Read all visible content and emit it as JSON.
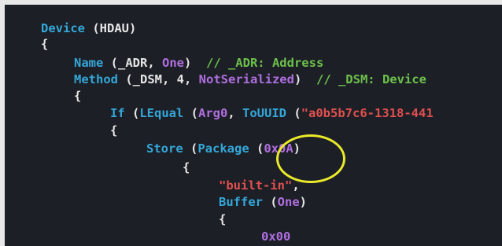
{
  "code": {
    "l1": {
      "kw": "Device",
      "rest": " (HDAU)"
    },
    "l2": {
      "text": "{"
    },
    "l3": {
      "kw": "Name",
      "p1": " (_ADR, ",
      "num": "One",
      "p2": ")  ",
      "comment": "// _ADR: Address"
    },
    "l4": {
      "kw": "Method",
      "p1": " (_DSM, 4, ",
      "num": "NotSerialized",
      "p2": ")  ",
      "comment": "// _DSM: Device"
    },
    "l5": {
      "text": "{"
    },
    "l6": {
      "kw1": "If",
      "p1": " (",
      "kw2": "LEqual",
      "p2": " (",
      "num": "Arg0",
      "p3": ", ",
      "kw3": "ToUUID",
      "p4": " (",
      "str": "\"a0b5b7c6-1318-441"
    },
    "l7": {
      "text": "{"
    },
    "l8": {
      "kw1": "Store",
      "p1": " (",
      "kw2": "Package",
      "p2": " (",
      "num": "0x0A",
      "p3": ")"
    },
    "l9": {
      "text": "{"
    },
    "l10": {
      "str": "\"built-in\"",
      "p1": ","
    },
    "l11": {
      "kw": "Buffer",
      "p1": " (",
      "num": "One",
      "p2": ")"
    },
    "l12": {
      "text": "{"
    },
    "l13": {
      "num": "0x00"
    }
  },
  "colors": {
    "background": "#1c1f26",
    "keyword": "#34a7d8",
    "string": "#e0504f",
    "number": "#b06fe0",
    "comment": "#6cc04a",
    "highlight": "#eaea2a"
  }
}
